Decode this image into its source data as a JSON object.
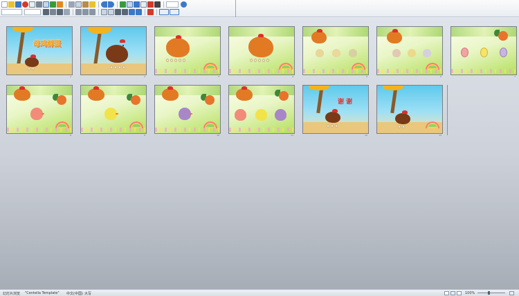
{
  "toolbar": {
    "row1": [
      "new-icon",
      "open-icon",
      "save-icon",
      "permission-icon",
      "email-icon",
      "print-icon",
      "print-preview-icon",
      "spelling-icon",
      "research-icon",
      "cut-icon",
      "copy-icon",
      "paste-icon",
      "format-painter-icon",
      "undo-icon",
      "redo-icon",
      "insert-hyperlink-icon",
      "expand-all-icon",
      "show-formatting-icon",
      "grayscale-icon",
      "zoom-combo",
      "help-icon"
    ],
    "row2": [
      "font-combo",
      "font-size-combo",
      "bold-icon",
      "italic-icon",
      "underline-icon",
      "shadow-icon",
      "align-left-icon",
      "center-icon",
      "align-right-icon",
      "numbering-icon",
      "bullets-icon",
      "increase-font-icon",
      "decrease-font-icon",
      "decrease-indent-icon",
      "increase-indent-icon",
      "font-color-icon",
      "design-icon",
      "new-slide-icon"
    ],
    "colors": {
      "blue": "#3b78c8",
      "green": "#3a9a3a",
      "orange": "#e08a22",
      "red": "#d23a2a",
      "gray": "#7a8592",
      "yellow": "#e8c230"
    }
  },
  "slides": [
    {
      "number": "1",
      "title": "母鸡孵蛋",
      "bg": "blue",
      "art": "title-hen"
    },
    {
      "number": "2",
      "bg": "blue",
      "art": "hen-tree"
    },
    {
      "number": "3",
      "bg": "green",
      "art": "orange-hen"
    },
    {
      "number": "4",
      "bg": "green",
      "art": "orange-hen"
    },
    {
      "number": "5",
      "bg": "green",
      "art": "hen-three-chicks"
    },
    {
      "number": "6",
      "bg": "green",
      "art": "hen-three-chicks-tinted"
    },
    {
      "number": "7",
      "bg": "green",
      "art": "three-eggs-rooster"
    },
    {
      "number": "8",
      "bg": "green",
      "art": "red-chick-rooster"
    },
    {
      "number": "9",
      "bg": "green",
      "art": "yellow-chick-rooster"
    },
    {
      "number": "10",
      "bg": "green",
      "art": "purple-chick-rooster"
    },
    {
      "number": "11",
      "bg": "green",
      "art": "three-chicks-rooster"
    },
    {
      "number": "12",
      "title": "谢 谢",
      "bg": "blue",
      "art": "thanks-hen"
    },
    {
      "number": "13",
      "bg": "blue",
      "art": "closing-hen"
    }
  ],
  "statusbar": {
    "view_label": "幻灯片浏览",
    "template": "\"Centella Template\"",
    "language": "中文(中国)",
    "extra": "大写",
    "zoom": "100%"
  }
}
